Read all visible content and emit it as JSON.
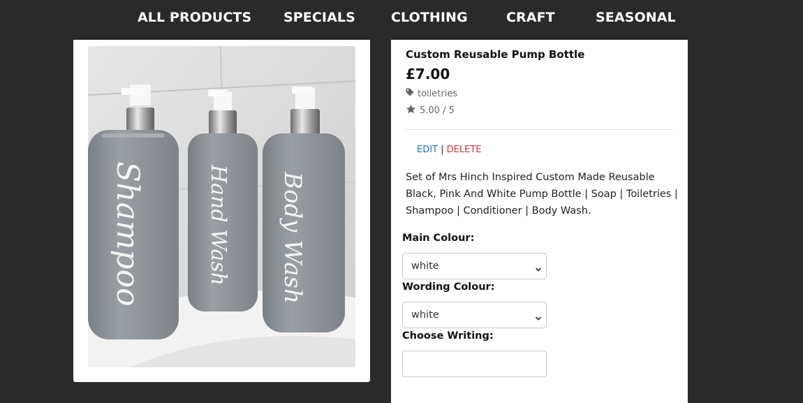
{
  "nav": {
    "items": [
      "ALL PRODUCTS",
      "SPECIALS",
      "CLOTHING",
      "CRAFT",
      "SEASONAL"
    ]
  },
  "product": {
    "image_labels": [
      "Shampoo",
      "Hand Wash",
      "Body Wash"
    ],
    "title": "Custom Reusable Pump Bottle",
    "price": "£7.00",
    "category": "toiletries",
    "rating": "5.00 / 5",
    "edit_label": "EDIT",
    "separator": "|",
    "delete_label": "DELETE",
    "description": "Set of Mrs Hinch Inspired Custom Made Reusable Black, Pink And White Pump Bottle | Soap | Toiletries | Shampoo | Conditioner | Body Wash."
  },
  "form": {
    "main_colour_label": "Main Colour:",
    "main_colour_value": "white",
    "wording_colour_label": "Wording Colour:",
    "wording_colour_value": "white",
    "writing_label": "Choose Writing:",
    "writing_value": ""
  },
  "colors": {
    "background": "#2a2a2a",
    "edit_link": "#1f6fd0",
    "delete_link": "#cc3344",
    "bottle": "#8c9196"
  },
  "icons": {
    "category": "tag-icon",
    "rating": "star-icon",
    "select": "chevron-down-icon"
  }
}
